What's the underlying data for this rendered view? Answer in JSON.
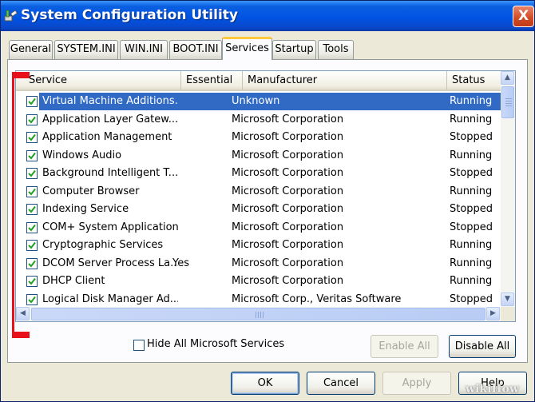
{
  "window": {
    "title": "System Configuration Utility",
    "close_glyph": "X"
  },
  "tabs": [
    {
      "label": "General"
    },
    {
      "label": "SYSTEM.INI"
    },
    {
      "label": "WIN.INI"
    },
    {
      "label": "BOOT.INI"
    },
    {
      "label": "Services",
      "active": true
    },
    {
      "label": "Startup"
    },
    {
      "label": "Tools"
    }
  ],
  "services_list": {
    "columns": [
      "Service",
      "Essential",
      "Manufacturer",
      "Status"
    ],
    "rows": [
      {
        "service": "Virtual Machine Additions...",
        "essential": "",
        "manufacturer": "Unknown",
        "status": "Running",
        "checked": true,
        "selected": true
      },
      {
        "service": "Application Layer Gatew...",
        "essential": "",
        "manufacturer": "Microsoft Corporation",
        "status": "Running",
        "checked": true
      },
      {
        "service": "Application Management",
        "essential": "",
        "manufacturer": "Microsoft Corporation",
        "status": "Stopped",
        "checked": true
      },
      {
        "service": "Windows Audio",
        "essential": "",
        "manufacturer": "Microsoft Corporation",
        "status": "Running",
        "checked": true
      },
      {
        "service": "Background Intelligent T...",
        "essential": "",
        "manufacturer": "Microsoft Corporation",
        "status": "Stopped",
        "checked": true
      },
      {
        "service": "Computer Browser",
        "essential": "",
        "manufacturer": "Microsoft Corporation",
        "status": "Running",
        "checked": true
      },
      {
        "service": "Indexing Service",
        "essential": "",
        "manufacturer": "Microsoft Corporation",
        "status": "Stopped",
        "checked": true
      },
      {
        "service": "COM+ System Application",
        "essential": "",
        "manufacturer": "Microsoft Corporation",
        "status": "Stopped",
        "checked": true
      },
      {
        "service": "Cryptographic Services",
        "essential": "",
        "manufacturer": "Microsoft Corporation",
        "status": "Running",
        "checked": true
      },
      {
        "service": "DCOM Server Process La...",
        "essential": "Yes",
        "manufacturer": "Microsoft Corporation",
        "status": "Running",
        "checked": true
      },
      {
        "service": "DHCP Client",
        "essential": "",
        "manufacturer": "Microsoft Corporation",
        "status": "Running",
        "checked": true
      },
      {
        "service": "Logical Disk Manager Ad...",
        "essential": "",
        "manufacturer": "Microsoft Corp., Veritas Software",
        "status": "Stopped",
        "checked": true
      }
    ]
  },
  "hide_ms": {
    "label": "Hide All Microsoft Services",
    "checked": false
  },
  "buttons": {
    "enable_all": "Enable All",
    "disable_all": "Disable All",
    "ok": "OK",
    "cancel": "Cancel",
    "apply": "Apply",
    "help": "Help"
  },
  "watermark": "wikiHow",
  "colors": {
    "title_bar": "#0054e3",
    "selection": "#316ac5",
    "active_tab_accent": "#ffc83c",
    "annotation_red": "#e8101a"
  }
}
